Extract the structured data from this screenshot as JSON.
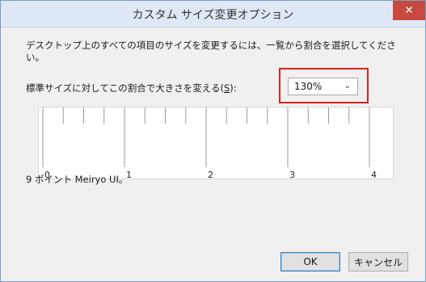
{
  "window": {
    "title": "カスタム サイズ変更オプション",
    "close_symbol": "✕"
  },
  "content": {
    "description": "デスクトップ上のすべての項目のサイズを変更するには、一覧から割合を選択してください。",
    "scale_label_prefix": "標準サイズに対してこの割合で大きさを変える(",
    "scale_label_mnemonic": "S",
    "scale_label_suffix": "):",
    "scale_select": {
      "selected": "130%",
      "chevron_icon": "chevron-down-icon"
    },
    "ruler": {
      "labels": [
        "0",
        "1",
        "2",
        "3",
        "4"
      ]
    },
    "font_note": "9 ポイント Meiryo UI。"
  },
  "buttons": {
    "ok": "OK",
    "cancel": "キャンセル"
  },
  "colors": {
    "highlight": "#e02020",
    "close_button": "#c74a3f",
    "titlebar": "#dfe9f5"
  }
}
